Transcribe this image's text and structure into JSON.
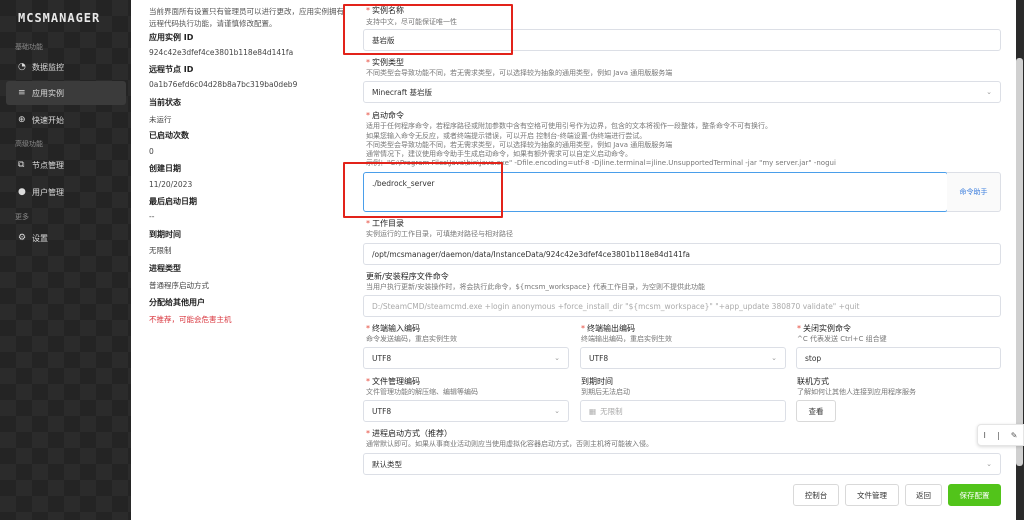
{
  "sidebar": {
    "logo": "MCSMANAGER",
    "groups": [
      "基础功能",
      "高级功能",
      "更多"
    ],
    "items": [
      {
        "label": "数据监控",
        "icon": "dashboard-icon"
      },
      {
        "label": "应用实例",
        "icon": "database-icon"
      },
      {
        "label": "快速开始",
        "icon": "plus-circle-icon"
      },
      {
        "label": "节点管理",
        "icon": "cluster-icon"
      },
      {
        "label": "用户管理",
        "icon": "user-icon"
      },
      {
        "label": "设置",
        "icon": "gear-icon"
      }
    ]
  },
  "info": {
    "note": "当前界面所有设置只有管理员可以进行更改，应用实例拥有远程代码执行功能，请谨慎修改配置。",
    "fields": [
      {
        "label": "应用实例 ID",
        "value": "924c42e3dfef4ce3801b118e84d141fa"
      },
      {
        "label": "远程节点 ID",
        "value": "0a1b76efd6c04d28b8a7bc319ba0deb9"
      },
      {
        "label": "当前状态",
        "value": "未运行"
      },
      {
        "label": "已启动次数",
        "value": "0"
      },
      {
        "label": "创建日期",
        "value": "11/20/2023"
      },
      {
        "label": "最后启动日期",
        "value": "--"
      },
      {
        "label": "到期时间",
        "value": "无限制"
      },
      {
        "label": "进程类型",
        "value": "普通程序启动方式"
      },
      {
        "label": "分配给其他用户",
        "value": "不推荐，可能会危害主机"
      }
    ]
  },
  "form": {
    "name": {
      "label": "实例名称",
      "desc": "支持中文，尽可能保证唯一性",
      "value": "基岩版"
    },
    "type": {
      "label": "实例类型",
      "desc": "不同类型会导致功能不同，若无需求类型，可以选择较为抽象的通用类型，例如 Java 通用版服务端",
      "value": "Minecraft 基岩版"
    },
    "start": {
      "label": "启动命令",
      "desc": [
        "适用于任何程序命令，若程序路径或附加参数中含有空格可使用引号作为边界，包含的文本将视作一段整体，整条命令不可有换行。",
        "如果您输入命令无反应，或者终端提示错误，可以开启 控制台-终端设置-伪终端进行尝试。",
        "不同类型会导致功能不同，若无需求类型，可以选择较为抽象的通用类型，例如 Java 通用版服务端",
        "通常情况下，建议使用命令助手生成启动命令，如果有额外需求可以自定义启动命令。",
        "示例：\"C:\\Program Files\\Java\\bin\\java.exe\" -Dfile.encoding=utf-8 -Djline.terminal=jline.UnsupportedTerminal -jar \"my server.jar\" -nogui"
      ],
      "value": "./bedrock_server",
      "helper": "命令助手"
    },
    "cwd": {
      "label": "工作目录",
      "desc": "实例运行的工作目录，可填绝对路径与相对路径",
      "value": "/opt/mcsmanager/daemon/data/InstanceData/924c42e3dfef4ce3801b118e84d141fa"
    },
    "update": {
      "label": "更新/安装程序文件命令",
      "desc": "当用户执行更新/安装操作时，将会执行此命令，${mcsm_workspace} 代表工作目录，为空则不提供此功能",
      "placeholder": "D:/SteamCMD/steamcmd.exe +login anonymous +force_install_dir \"${mcsm_workspace}\" \"+app_update 380870 validate\" +quit"
    },
    "in_enc": {
      "label": "终端输入编码",
      "desc": "命令发送编码，重启实例生效",
      "value": "UTF8"
    },
    "out_enc": {
      "label": "终端输出编码",
      "desc": "终端输出编码，重启实例生效",
      "value": "UTF8"
    },
    "stop": {
      "label": "关闭实例命令",
      "desc": "^C 代表发送 Ctrl+C 组合键",
      "value": "stop"
    },
    "file_enc": {
      "label": "文件管理编码",
      "desc": "文件管理功能的解压缩、编辑等编码",
      "value": "UTF8"
    },
    "expire": {
      "label": "到期时间",
      "desc": "到期后无法启动",
      "placeholder": "无限制"
    },
    "network": {
      "label": "联机方式",
      "desc": "了解如何让其他人连接到应用程序服务",
      "button": "查看"
    },
    "process": {
      "label": "进程启动方式（推荐）",
      "desc": "通常默认即可。如果从事商业活动则应当使用虚拟化容器启动方式，否则主机将可能被入侵。",
      "value": "默认类型"
    }
  },
  "footer": {
    "console": "控制台",
    "files": "文件管理",
    "back": "返回",
    "save": "保存配置"
  },
  "floatTool": {
    "sep": "|",
    "icon": "pen-icon"
  }
}
